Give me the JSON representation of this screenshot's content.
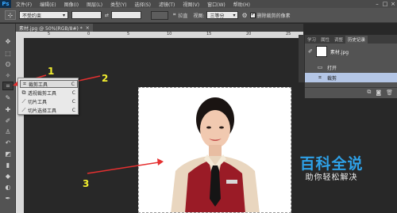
{
  "app": {
    "logo": "Ps"
  },
  "menubar": {
    "items": [
      "文件(F)",
      "编辑(E)",
      "图像(I)",
      "图层(L)",
      "类型(Y)",
      "选择(S)",
      "滤镜(T)",
      "视图(V)",
      "窗口(W)",
      "帮助(H)"
    ]
  },
  "options_bar": {
    "ratio_select": "不受约束",
    "straighten_label": "拉直",
    "view_label": "视图:",
    "view_select": "三等分",
    "delete_cropped_label": "删除裁剪的像素"
  },
  "document_tab": {
    "title": "素材.jpg @ 50%(RGB/8#) *",
    "close": "×"
  },
  "rulers": {
    "top_numbers": [
      "5",
      "0",
      "5",
      "10",
      "15",
      "20",
      "25"
    ]
  },
  "flyout": {
    "items": [
      {
        "label": "裁剪工具",
        "shortcut": "C",
        "icon": "crop-icon",
        "selected": true
      },
      {
        "label": "透视裁剪工具",
        "shortcut": "C",
        "icon": "perspective-crop-icon",
        "selected": false
      },
      {
        "label": "切片工具",
        "shortcut": "C",
        "icon": "slice-icon",
        "selected": false
      },
      {
        "label": "切片选择工具",
        "shortcut": "C",
        "icon": "slice-select-icon",
        "selected": false
      }
    ]
  },
  "annotations": {
    "n1": "1",
    "n2": "2",
    "n3": "3",
    "color": "#e53030",
    "number_color": "#f2ee2e"
  },
  "history_panel": {
    "tabs": [
      "学习",
      "属性",
      "调整",
      "历史记录"
    ],
    "snapshot_label": "素材.jpg",
    "rows": [
      {
        "label": "打开",
        "icon": "document-icon",
        "selected": false
      },
      {
        "label": "裁剪",
        "icon": "crop-icon",
        "selected": true
      }
    ]
  },
  "watermark": {
    "title": "百科全说",
    "subtitle": "助你轻松解决"
  }
}
